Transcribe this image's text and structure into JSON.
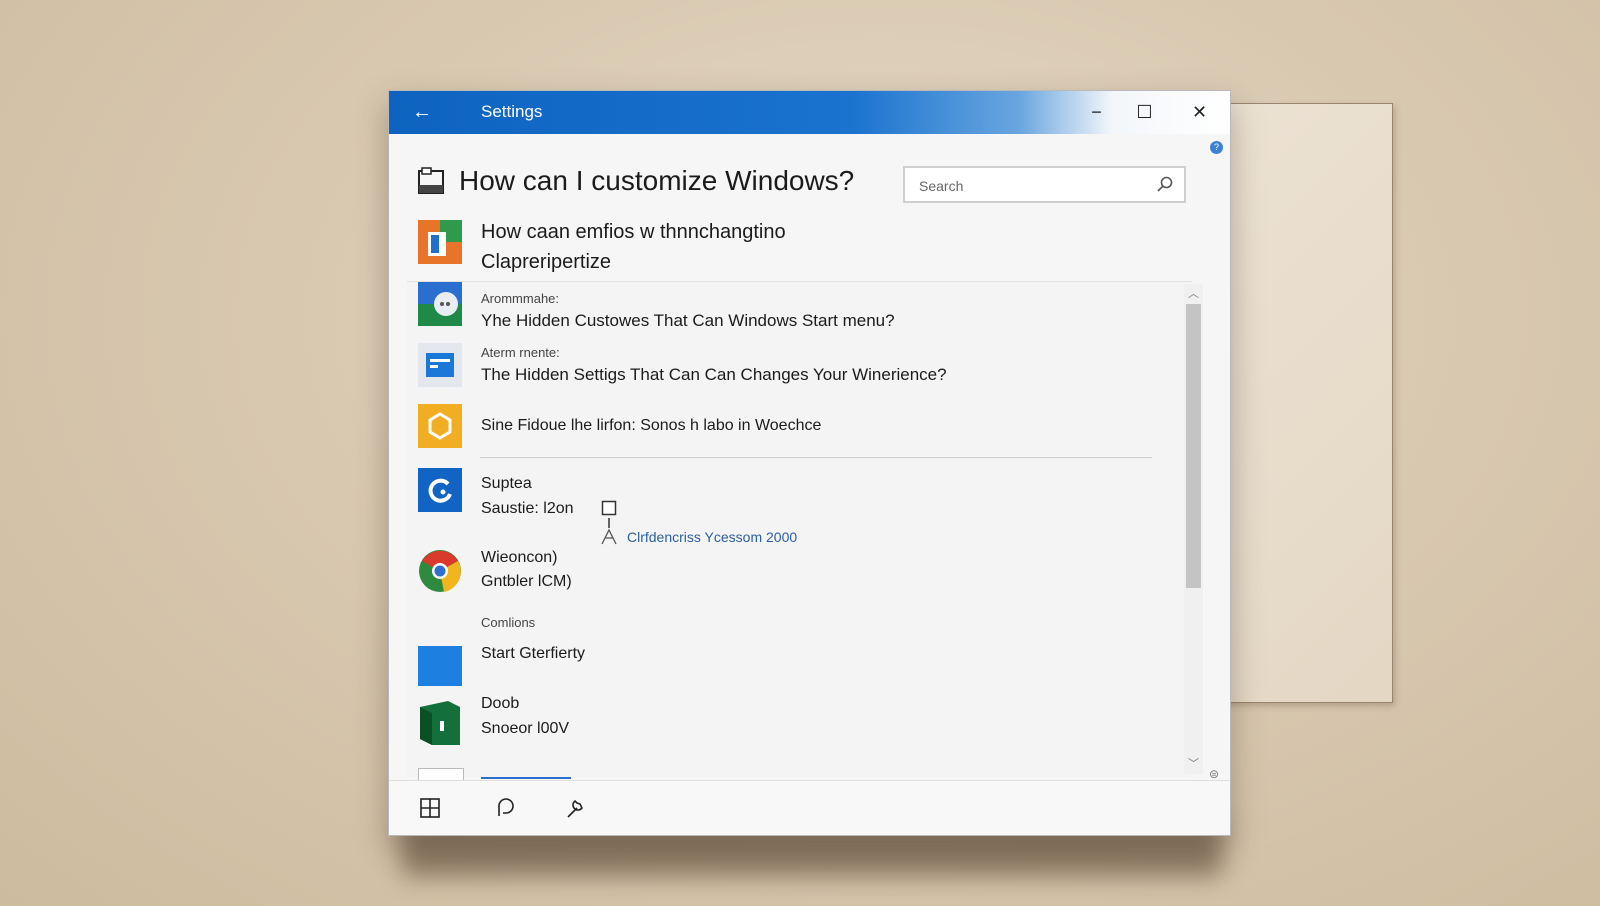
{
  "window": {
    "title": "Settings",
    "back_label": "←",
    "minimize": "−",
    "maximize": "☐",
    "close": "✕",
    "help_badge": "?"
  },
  "header": {
    "page_title": "How can I customize Windows?",
    "search_placeholder": "Search"
  },
  "items": [
    {
      "icon": "orange-document-app-icon",
      "line1": "How caan emfios w thnnchangtino",
      "line2": "Clapreripertize"
    },
    {
      "icon": "green-chat-app-icon",
      "category": "Arommmahe:",
      "line1": "Yhe Hidden Custowes That Can Windows Start menu?"
    },
    {
      "icon": "blue-window-app-icon",
      "category": "Aterm rnente:",
      "line1": "The Hidden Settigs That Can Can Changes Your Winerience?"
    },
    {
      "icon": "yellow-hexagon-app-icon",
      "line1": "Sine Fidoue lhe lirfon: Sonos h labo in Woechce"
    },
    {
      "icon": "blue-refresh-app-icon",
      "line1": "Suptea",
      "line2": "Saustie: l2on"
    },
    {
      "icon": "chrome-style-app-icon",
      "line1": "Wieoncon)",
      "line2": "Gntbler lCM)"
    },
    {
      "icon": "blue-square-app-icon",
      "category": "Comlions",
      "line1": "Start Gterfierty"
    },
    {
      "icon": "green-book-app-icon",
      "line1": "Doob",
      "line2": "Snoeor l00V"
    }
  ],
  "annotation": {
    "text": "Clrfdencriss Ycessom 2000",
    "pointer_icon": "cursor-a-icon",
    "checkbox_icon": "checkbox-icon"
  },
  "scroll": {
    "up_glyph": "︿",
    "down_glyph": "﹀",
    "end_glyph": "⊜"
  },
  "footer": {
    "buttons": [
      "windows-grid-icon",
      "chat-bubble-icon",
      "wrench-icon"
    ]
  }
}
